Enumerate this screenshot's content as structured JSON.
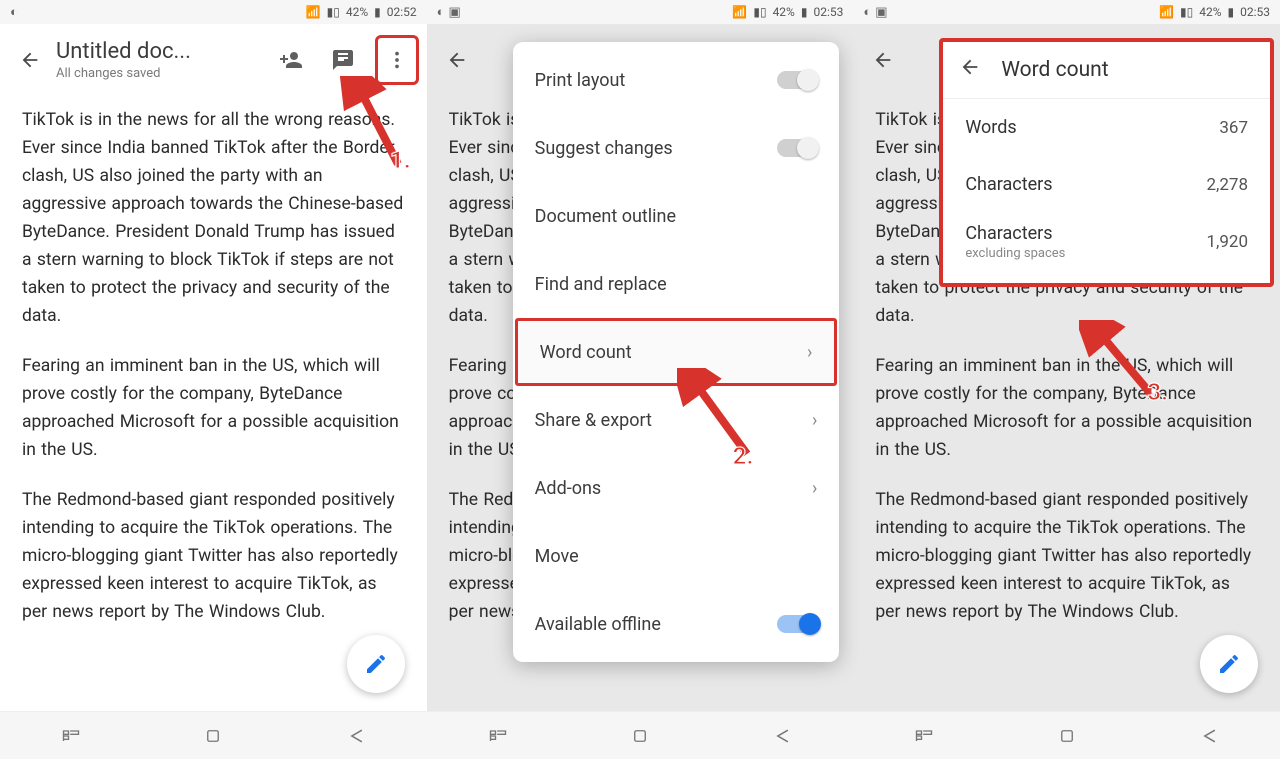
{
  "status": {
    "battery_pct": "42%",
    "time1": "02:52",
    "time2": "02:53",
    "time3": "02:53"
  },
  "doc": {
    "title": "Untitled doc...",
    "subtitle": "All changes saved",
    "paragraph1": "TikTok is in the news for all the wrong reasons. Ever since India banned TikTok after the Border clash, US also joined the party with an aggressive approach towards the Chinese-based ByteDance. President Donald Trump has issued a stern warning to block TikTok if steps are not taken to protect the privacy and security of the data.",
    "paragraph2": "Fearing an imminent ban in the US, which will prove costly for the company, ByteDance approached Microsoft for a possible acquisition in the US.",
    "paragraph3": "The Redmond-based giant responded positively intending to acquire the TikTok operations. The micro-blogging giant Twitter has also reportedly expressed keen interest to acquire TikTok, as per news report by The Windows Club."
  },
  "menu": {
    "print_layout": "Print layout",
    "suggest_changes": "Suggest changes",
    "document_outline": "Document outline",
    "find_replace": "Find and replace",
    "word_count": "Word count",
    "share_export": "Share & export",
    "addons": "Add-ons",
    "move": "Move",
    "available_offline": "Available offline"
  },
  "wordcount": {
    "title": "Word count",
    "words_label": "Words",
    "words_value": "367",
    "chars_label": "Characters",
    "chars_value": "2,278",
    "chars_ex_label": "Characters",
    "chars_ex_sub": "excluding spaces",
    "chars_ex_value": "1,920"
  },
  "annotations": {
    "step1": "1.",
    "step2": "2.",
    "step3": "3."
  }
}
